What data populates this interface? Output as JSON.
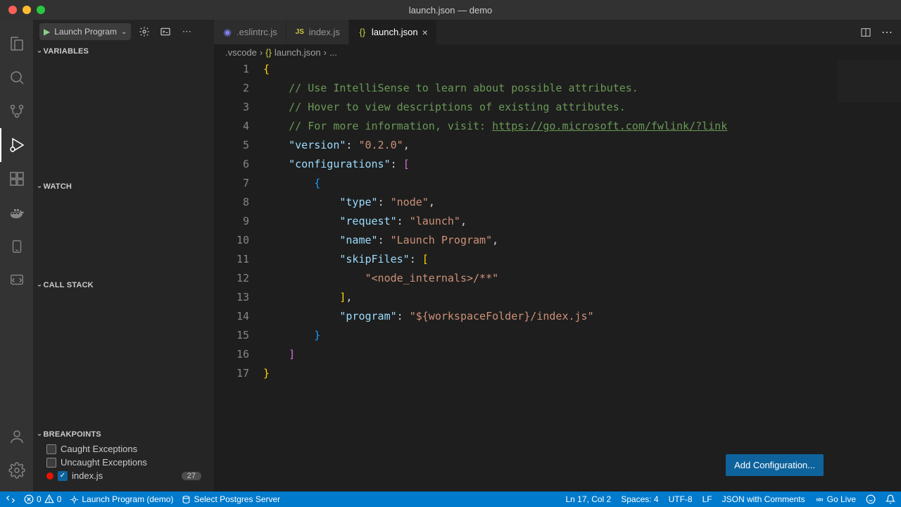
{
  "window": {
    "title": "launch.json — demo"
  },
  "sidebar": {
    "launch_config": "Launch Program",
    "sections": {
      "variables": "VARIABLES",
      "watch": "WATCH",
      "callstack": "CALL STACK",
      "breakpoints": "BREAKPOINTS"
    },
    "breakpoints": {
      "caught": "Caught Exceptions",
      "uncaught": "Uncaught Exceptions",
      "file": "index.js",
      "file_line": "27"
    }
  },
  "tabs": {
    "t1": ".eslintrc.js",
    "t2": "index.js",
    "t3": "launch.json"
  },
  "breadcrumb": {
    "p1": ".vscode",
    "p2": "launch.json",
    "p3": "..."
  },
  "editor": {
    "lines": [
      "1",
      "2",
      "3",
      "4",
      "5",
      "6",
      "7",
      "8",
      "9",
      "10",
      "11",
      "12",
      "13",
      "14",
      "15",
      "16",
      "17"
    ],
    "content": {
      "comment1": "// Use IntelliSense to learn about possible attributes.",
      "comment2": "// Hover to view descriptions of existing attributes.",
      "comment3_a": "// For more information, visit: ",
      "comment3_b": "https://go.microsoft.com/fwlink/?link",
      "version_k": "\"version\"",
      "version_v": "\"0.2.0\"",
      "configs_k": "\"configurations\"",
      "type_k": "\"type\"",
      "type_v": "\"node\"",
      "request_k": "\"request\"",
      "request_v": "\"launch\"",
      "name_k": "\"name\"",
      "name_v": "\"Launch Program\"",
      "skip_k": "\"skipFiles\"",
      "skip_v": "\"<node_internals>/**\"",
      "program_k": "\"program\"",
      "program_v": "\"${workspaceFolder}/index.js\""
    }
  },
  "buttons": {
    "add_config": "Add Configuration..."
  },
  "status": {
    "errors": "0",
    "warnings": "0",
    "launch": "Launch Program (demo)",
    "postgres": "Select Postgres Server",
    "cursor": "Ln 17, Col 2",
    "spaces": "Spaces: 4",
    "encoding": "UTF-8",
    "eol": "LF",
    "lang": "JSON with Comments",
    "golive": "Go Live"
  }
}
